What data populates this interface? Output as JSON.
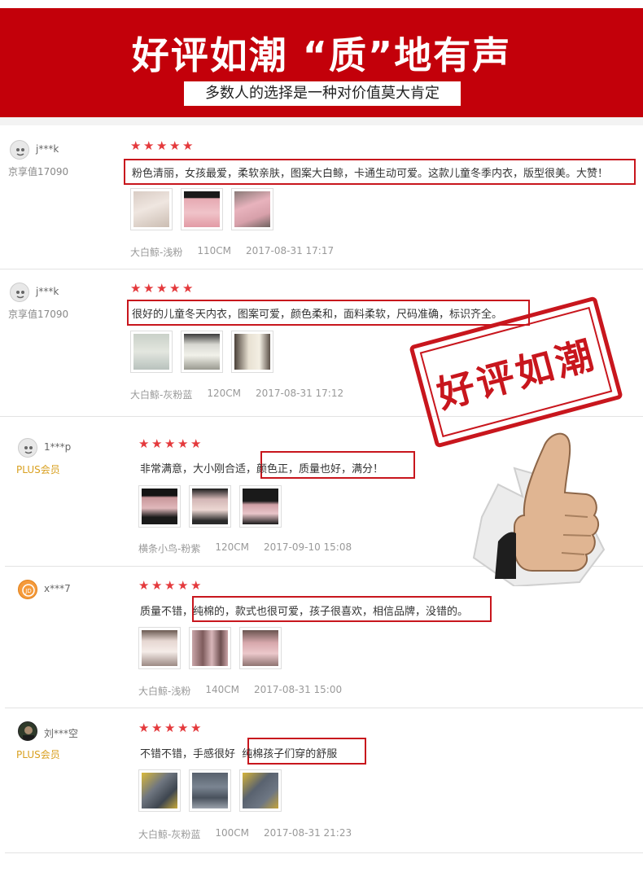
{
  "banner": {
    "title": "好评如潮 “质”地有声",
    "subtitle": "多数人的选择是一种对价值莫大肯定"
  },
  "stamp": {
    "text": "好评如潮"
  },
  "reviews": [
    {
      "user": "j***k",
      "level": "京享值17090",
      "rating": 5,
      "plain": "",
      "highlighted": "粉色清丽，女孩最爱，柔软亲肤，图案大白鲸，卡通生动可爱。这款儿童冬季内衣，版型很美。大赞！",
      "variant": "大白鲸-浅粉",
      "size": "110CM",
      "time": "2017-08-31 17:17"
    },
    {
      "user": "j***k",
      "level": "京享值17090",
      "rating": 5,
      "plain": "",
      "highlighted": "很好的儿童冬天内衣，图案可爱，颜色柔和，面料柔软，尺码准确，标识齐全。",
      "variant": "大白鲸-灰粉蓝",
      "size": "120CM",
      "time": "2017-08-31 17:12"
    },
    {
      "user": "1***p",
      "level": "PLUS会员",
      "rating": 5,
      "plain": "非常满意，大小刚合适，",
      "highlighted": "颜色正，质量也好，满分！",
      "variant": "横条小鸟-粉紫",
      "size": "120CM",
      "time": "2017-09-10 15:08"
    },
    {
      "user": "x***7",
      "level": "",
      "rating": 5,
      "plain": "质量不错，",
      "highlighted": "纯棉的，款式也很可爱，孩子很喜欢，相信品牌，没错的。",
      "variant": "大白鲸-浅粉",
      "size": "140CM",
      "time": "2017-08-31 15:00"
    },
    {
      "user": "刘***空",
      "level": "PLUS会员",
      "rating": 5,
      "plain": "不错不错，手感很好",
      "highlighted": "纯棉孩子们穿的舒服",
      "variant": "大白鲸-灰粉蓝",
      "size": "100CM",
      "time": "2017-08-31 21:23"
    }
  ],
  "colors": {
    "banner": "#c3000a",
    "star": "#e4393c",
    "highlight_border": "#c8161d",
    "plus": "#d9a020"
  }
}
